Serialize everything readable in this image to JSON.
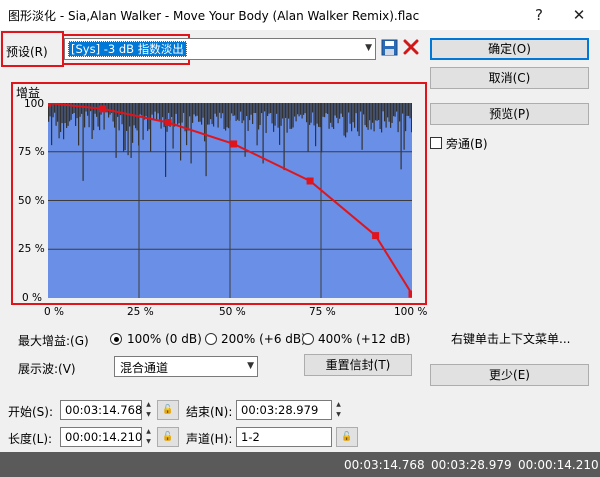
{
  "window": {
    "title": "图形淡化 - Sia,Alan Walker - Move Your Body (Alan Walker Remix).flac",
    "help_label": "?",
    "close_label": "✕"
  },
  "preset": {
    "label": "预设(R)",
    "value": "[Sys] -3 dB 指数淡出",
    "save_icon": "save-icon",
    "delete_icon": "delete-icon"
  },
  "buttons": {
    "ok": "确定(O)",
    "cancel": "取消(C)",
    "preview": "预览(P)",
    "reset_envelope": "重置信封(T)",
    "less": "更少(E)"
  },
  "bypass": {
    "label": "旁通(B)",
    "checked": false
  },
  "graph": {
    "title": "增益",
    "y_ticks": [
      "100",
      "75 %",
      "50 %",
      "25 %",
      "0 %"
    ],
    "x_ticks": [
      "0 %",
      "25 %",
      "50 %",
      "75 %",
      "100 %"
    ],
    "waveform_color": "#333333",
    "background_color": "#6a8fe6",
    "envelope_color": "#e0151c"
  },
  "chart_data": {
    "type": "line",
    "title": "增益",
    "x": [
      0,
      15,
      33,
      51,
      72,
      90,
      100
    ],
    "y": [
      100,
      97,
      90,
      79,
      60,
      32,
      2
    ],
    "xlim": [
      0,
      100
    ],
    "ylim": [
      0,
      100
    ],
    "grid": true
  },
  "max_gain": {
    "label": "最大增益:(G)",
    "options": [
      "100% (0 dB)",
      "200% (+6 dB)",
      "400% (+12 dB)"
    ],
    "selected": 0
  },
  "show_wave": {
    "label": "展示波:(V)",
    "value": "混合通道"
  },
  "context_hint": "右键单击上下文菜单...",
  "range": {
    "start_label": "开始(S):",
    "start_value": "00:03:14.768",
    "end_label": "结束(N):",
    "end_value": "00:03:28.979",
    "length_label": "长度(L):",
    "length_value": "00:00:14.210",
    "channel_label": "声道(H):",
    "channel_value": "1-2"
  },
  "status": {
    "start": "00:03:14.768",
    "end": "00:03:28.979",
    "length": "00:00:14.210"
  }
}
